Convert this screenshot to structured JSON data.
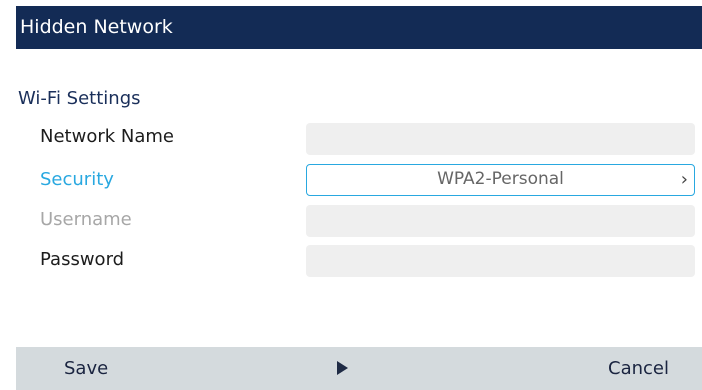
{
  "header": {
    "title": "Hidden Network"
  },
  "section": {
    "title": "Wi-Fi Settings"
  },
  "rows": [
    {
      "label": "Network Name",
      "value": ""
    },
    {
      "label": "Security",
      "value": "WPA2-Personal"
    },
    {
      "label": "Username",
      "value": ""
    },
    {
      "label": "Password",
      "value": ""
    }
  ],
  "softkeys": {
    "save": "Save",
    "cancel": "Cancel"
  },
  "icons": {
    "security_chevron": "chevron-right-icon",
    "softkey_arrow": "play-arrow-icon"
  },
  "colors": {
    "title_bar": "#132b55",
    "selected_text": "#29a8e0",
    "disabled_text": "#a7a7a7",
    "softkey_bar": "#d4dadd"
  }
}
